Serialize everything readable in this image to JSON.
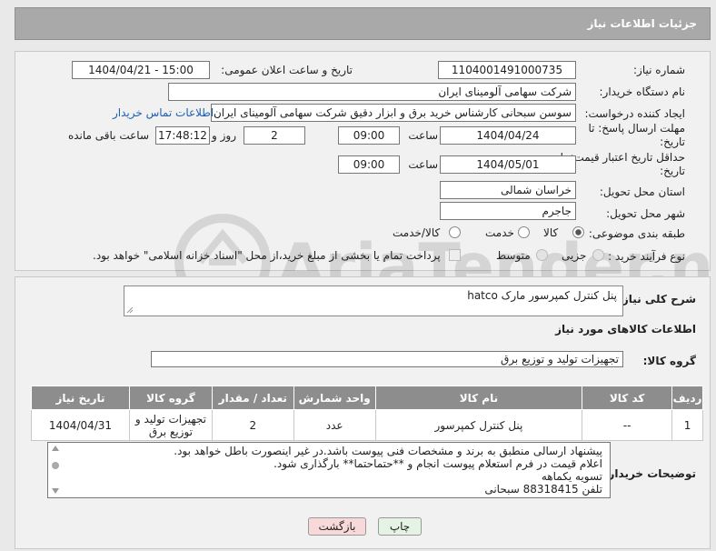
{
  "header": {
    "title": "جزئیات اطلاعات نیاز"
  },
  "fields": {
    "need_number_label": "شماره نیاز:",
    "need_number": "1104001491000735",
    "announce_label": "تاریخ و ساعت اعلان عمومی:",
    "announce_value": "1404/04/21 - 15:00",
    "buyer_org_label": "نام دستگاه خریدار:",
    "buyer_org": "شرکت سهامی آلومینای ایران",
    "creator_label": "ایجاد کننده درخواست:",
    "creator": "سوسن سبحانی کارشناس خرید برق و ابزار دقیق شرکت سهامی آلومینای ایران",
    "contact_link": "اطلاعات تماس خریدار",
    "deadline_label": "مهلت ارسال پاسخ: تا تاریخ:",
    "deadline_date": "1404/04/24",
    "time_label": "ساعت",
    "deadline_time": "09:00",
    "days_value": "2",
    "days_label": "روز و",
    "remaining_time": "17:48:12",
    "remaining_label": "ساعت باقی مانده",
    "validity_label": "حداقل تاریخ اعتبار قیمت: تا تاریخ:",
    "validity_date": "1404/05/01",
    "validity_time": "09:00",
    "province_label": "استان محل تحویل:",
    "province": "خراسان شمالی",
    "city_label": "شهر محل تحویل:",
    "city": "جاجرم",
    "category_label": "طبقه بندی موضوعی:",
    "category_options": [
      "کالا",
      "خدمت",
      "کالا/خدمت"
    ],
    "category_selected": "کالا",
    "process_label": "نوع فرآیند خرید :",
    "process_options": [
      "جزیی",
      "متوسط"
    ],
    "payment_note": "پرداخت تمام یا بخشی از مبلغ خرید،از محل \"اسناد خزانه اسلامی\" خواهد بود."
  },
  "description": {
    "label": "شرح کلی نیاز:",
    "value": "پنل کنترل کمپرسور مارک hatco"
  },
  "goods_section": {
    "title": "اطلاعات کالاهای مورد نیاز",
    "group_label": "گروه کالا:",
    "group_value": "تجهیزات تولید و توزیع برق"
  },
  "table": {
    "headers": {
      "row": "ردیف",
      "code": "کد کالا",
      "name": "نام کالا",
      "unit": "واحد شمارش",
      "qty": "تعداد / مقدار",
      "group": "گروه کالا",
      "date": "تاریخ نیاز"
    },
    "rows": [
      {
        "row": "1",
        "code": "--",
        "name": "پنل کنترل کمپرسور",
        "unit": "عدد",
        "qty": "2",
        "group": "تجهیزات تولید و توزیع برق",
        "date": "1404/04/31"
      }
    ]
  },
  "buyer_notes": {
    "label": "توضیحات خریدار:",
    "lines": [
      "پیشنهاد ارسالی منطبق به برند و مشخصات فنی پیوست باشد.در غیر اینصورت باطل خواهد بود.",
      "اعلام قیمت در فرم استعلام پیوست انجام و **حتماحتما** بارگذاری شود.",
      "تسویه یکماهه",
      "تلفن 88318415 سبحانی"
    ]
  },
  "buttons": {
    "print": "چاپ",
    "back": "بازگشت"
  },
  "watermark": {
    "brand": "AriaTender.neT"
  },
  "colors": {
    "header_bg": "#a9a9a9",
    "table_header_bg": "#8d8d8d",
    "back_button_bg": "#f7d9d9",
    "print_button_bg": "#e4f3e4",
    "link": "#1f5fb0"
  }
}
